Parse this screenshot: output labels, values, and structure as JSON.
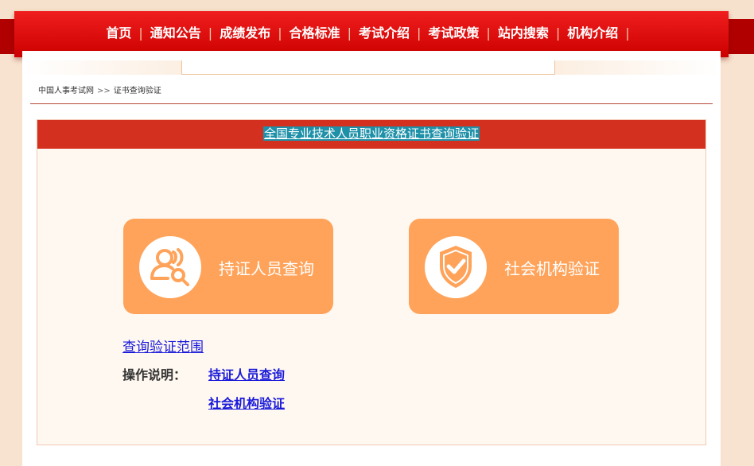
{
  "nav": {
    "items": [
      "首页",
      "通知公告",
      "成绩发布",
      "合格标准",
      "考试介绍",
      "考试政策",
      "站内搜索",
      "机构介绍"
    ],
    "separator": "|"
  },
  "breadcrumb": {
    "home": "中国人事考试网",
    "separator": ">>",
    "current": "证书查询验证"
  },
  "panel": {
    "title": "全国专业技术人员职业资格证书查询验证"
  },
  "buttons": {
    "holder_query": "持证人员查询",
    "org_verify": "社会机构验证"
  },
  "links": {
    "scope": "查询验证范围",
    "operation_label": "操作说明：",
    "operation_holder": "持证人员查询",
    "operation_org": "社会机构验证"
  },
  "colors": {
    "nav_red": "#cc0000",
    "panel_header": "#d3301f",
    "button_orange": "#ffa35a",
    "link_blue": "#1a1adb"
  },
  "icons": {
    "holder_query": "person-search-icon",
    "org_verify": "shield-check-icon"
  }
}
